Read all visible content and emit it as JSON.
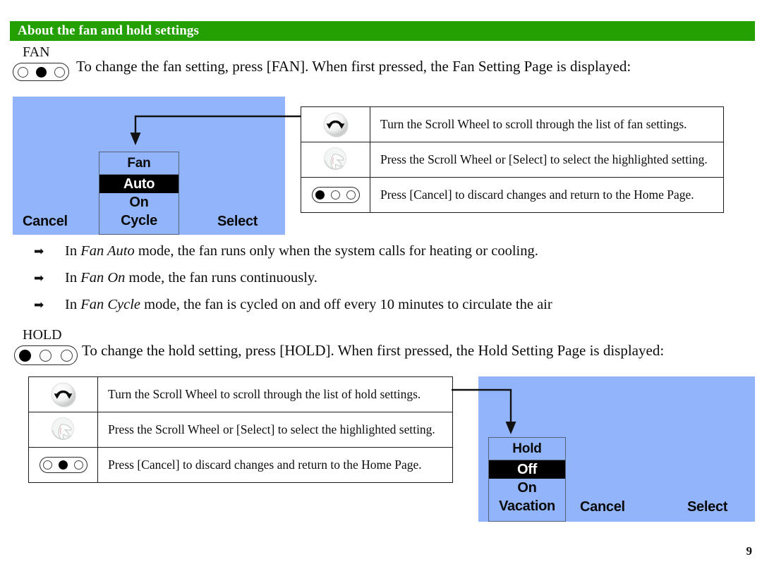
{
  "header": {
    "title": "About the fan and hold settings",
    "bar_color": "#25a003",
    "text_color": "#ffffff"
  },
  "page_number": "9",
  "palette": {
    "lcd_blue": "#92b4fb",
    "highlight_black": "#000000",
    "highlight_text": "#ffffff",
    "ink": "#0d0d0d"
  },
  "fan_section": {
    "key_label": "FAN",
    "key_button": {
      "icon": "three-dot-pill-button",
      "dots": [
        "empty",
        "filled",
        "empty"
      ]
    },
    "sentence": "To change the fan setting, press [FAN].  When first pressed, the Fan Setting Page is displayed:",
    "lcd": {
      "title": "Fan",
      "items": [
        {
          "label": "Auto",
          "highlighted": true
        },
        {
          "label": "On",
          "highlighted": false
        },
        {
          "label": "Cycle",
          "highlighted": false
        }
      ],
      "softkeys": {
        "left": "Cancel",
        "center": "Cycle",
        "right": "Select"
      }
    },
    "table": {
      "rows": [
        {
          "icon": "scroll-wheel-rotate-icon",
          "text": "Turn the Scroll Wheel to scroll through the list of fan settings."
        },
        {
          "icon": "hand-press-wheel-icon",
          "text": "Press the Scroll Wheel or [Select] to select the highlighted setting."
        },
        {
          "icon": "three-dot-pill-button",
          "dots": [
            "filled",
            "empty",
            "empty"
          ],
          "text": "Press [Cancel] to discard changes and return to the Home Page."
        }
      ]
    }
  },
  "bullets": [
    {
      "pre": "In ",
      "em": "Fan Auto",
      "post": " mode, the fan runs only when the system calls for heating or cooling."
    },
    {
      "pre": "In ",
      "em": "Fan On",
      "post": " mode, the fan runs continuously."
    },
    {
      "pre": "In ",
      "em": "Fan Cycle",
      "post": " mode, the fan is cycled on and off every 10 minutes to circulate the air"
    }
  ],
  "hold_section": {
    "key_label": "HOLD",
    "key_button": {
      "icon": "three-dot-pill-button",
      "dots": [
        "filled",
        "empty",
        "empty"
      ]
    },
    "sentence": "To change the hold setting, press [HOLD].  When first pressed, the Hold Setting Page is displayed:",
    "table": {
      "rows": [
        {
          "icon": "scroll-wheel-rotate-icon",
          "text": "Turn the Scroll Wheel to scroll through the list of hold settings."
        },
        {
          "icon": "hand-press-wheel-icon",
          "text": "Press the Scroll Wheel or [Select] to select the highlighted setting."
        },
        {
          "icon": "three-dot-pill-button",
          "dots": [
            "empty",
            "filled",
            "empty"
          ],
          "text": "Press [Cancel] to discard changes and return to the Home Page."
        }
      ]
    },
    "lcd": {
      "title": "Hold",
      "items": [
        {
          "label": "Off",
          "highlighted": true
        },
        {
          "label": "On",
          "highlighted": false
        },
        {
          "label": "Vacation",
          "highlighted": false
        }
      ],
      "softkeys": {
        "left": "Cancel",
        "right": "Select"
      }
    }
  }
}
